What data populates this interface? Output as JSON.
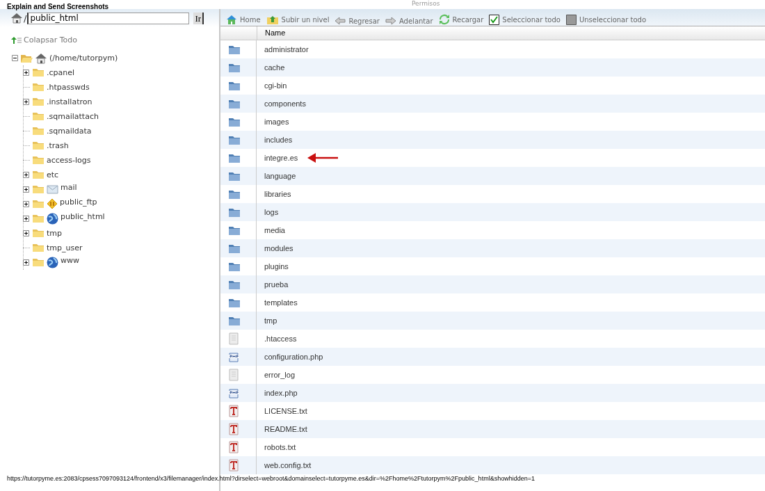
{
  "caption": "Explain and Send Screenshots",
  "header_title": "Permisos",
  "address": {
    "separator": "/",
    "value": "public_html",
    "button": "Ir"
  },
  "collapse_all": "Colapsar Todo",
  "tree": {
    "label": "(/home/tutorpym)",
    "expanded": true,
    "children": [
      {
        "label": ".cpanel",
        "kind": "folder",
        "expandable": true
      },
      {
        "label": ".htpasswds",
        "kind": "folder",
        "expandable": false
      },
      {
        "label": ".installatron",
        "kind": "folder",
        "expandable": true
      },
      {
        "label": ".sqmailattach",
        "kind": "folder",
        "expandable": false
      },
      {
        "label": ".sqmaildata",
        "kind": "folder",
        "expandable": false
      },
      {
        "label": ".trash",
        "kind": "folder",
        "expandable": false
      },
      {
        "label": "access-logs",
        "kind": "folder",
        "expandable": false
      },
      {
        "label": "etc",
        "kind": "folder",
        "expandable": true
      },
      {
        "label": "mail",
        "kind": "mail",
        "expandable": true
      },
      {
        "label": "public_ftp",
        "kind": "ftp",
        "expandable": true
      },
      {
        "label": "public_html",
        "kind": "web",
        "expandable": true
      },
      {
        "label": "tmp",
        "kind": "folder",
        "expandable": true
      },
      {
        "label": "tmp_user",
        "kind": "folder",
        "expandable": false
      },
      {
        "label": "www",
        "kind": "web",
        "expandable": true
      }
    ]
  },
  "toolbar": [
    {
      "label": "Home",
      "kind": "home"
    },
    {
      "label": "Subir un nivel",
      "kind": "up"
    },
    {
      "label": "Regresar",
      "kind": "back"
    },
    {
      "label": "Adelantar",
      "kind": "forward"
    },
    {
      "label": "Recargar",
      "kind": "reload"
    },
    {
      "label": "Seleccionar todo",
      "kind": "checkall"
    },
    {
      "label": "Unseleccionar todo",
      "kind": "uncheckall"
    }
  ],
  "table": {
    "columns": [
      "Name"
    ],
    "rows": [
      {
        "name": "administrator",
        "kind": "folder",
        "marked": false
      },
      {
        "name": "cache",
        "kind": "folder",
        "marked": false
      },
      {
        "name": "cgi-bin",
        "kind": "folder",
        "marked": false
      },
      {
        "name": "components",
        "kind": "folder",
        "marked": false
      },
      {
        "name": "images",
        "kind": "folder",
        "marked": false
      },
      {
        "name": "includes",
        "kind": "folder",
        "marked": false
      },
      {
        "name": "integre.es",
        "kind": "folder",
        "marked": true
      },
      {
        "name": "language",
        "kind": "folder",
        "marked": false
      },
      {
        "name": "libraries",
        "kind": "folder",
        "marked": false
      },
      {
        "name": "logs",
        "kind": "folder",
        "marked": false
      },
      {
        "name": "media",
        "kind": "folder",
        "marked": false
      },
      {
        "name": "modules",
        "kind": "folder",
        "marked": false
      },
      {
        "name": "plugins",
        "kind": "folder",
        "marked": false
      },
      {
        "name": "prueba",
        "kind": "folder",
        "marked": false
      },
      {
        "name": "templates",
        "kind": "folder",
        "marked": false
      },
      {
        "name": "tmp",
        "kind": "folder",
        "marked": false
      },
      {
        "name": ".htaccess",
        "kind": "file",
        "marked": false
      },
      {
        "name": "configuration.php",
        "kind": "php",
        "marked": false
      },
      {
        "name": "error_log",
        "kind": "file",
        "marked": false
      },
      {
        "name": "index.php",
        "kind": "php",
        "marked": false
      },
      {
        "name": "LICENSE.txt",
        "kind": "text",
        "marked": false
      },
      {
        "name": "README.txt",
        "kind": "text",
        "marked": false
      },
      {
        "name": "robots.txt",
        "kind": "text",
        "marked": false
      },
      {
        "name": "web.config.txt",
        "kind": "text",
        "marked": false
      }
    ]
  },
  "status_bar": {
    "url": "https://tutorpyme.es:2083/cpsess7097093124/frontend/x3/filemanager/index.html?dirselect=webroot&domainselect=tutorpyme.es&dir=%2Fhome%2Ftutorpym%2Fpublic_html&showhidden=1"
  }
}
